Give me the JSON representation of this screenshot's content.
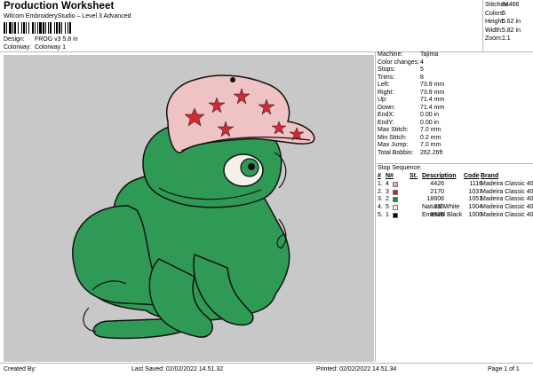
{
  "header": {
    "title": "Production Worksheet",
    "subtitle": "Wilcom EmbroideryStudio – Level 3 Advanced",
    "barcode_label": "barcode",
    "design_label": "Design:",
    "design_value": "FROG v3 5.8 in",
    "colorway_label": "Colorway:",
    "colorway_value": "Colorway 1"
  },
  "summary": [
    {
      "label": "Stitches:",
      "value": "34466"
    },
    {
      "label": "Colors:",
      "value": "5"
    },
    {
      "label": "Height:",
      "value": "5.62 in"
    },
    {
      "label": "Width:",
      "value": "5.82 in"
    },
    {
      "label": "Zoom:",
      "value": "1:1"
    }
  ],
  "machine_info": [
    {
      "label": "Machine:",
      "value": "Tajima"
    },
    {
      "label": "Color changes:",
      "value": "4"
    },
    {
      "label": "Stops:",
      "value": "5"
    },
    {
      "label": "Trims:",
      "value": "8"
    },
    {
      "label": "Left:",
      "value": "73.9 mm"
    },
    {
      "label": "Right:",
      "value": "73.9 mm"
    },
    {
      "label": "Up:",
      "value": "71.4 mm"
    },
    {
      "label": "Down:",
      "value": "71.4 mm"
    },
    {
      "label": "EndX:",
      "value": "0.00 in"
    },
    {
      "label": "EndY:",
      "value": "0.00 in"
    },
    {
      "label": "Max Stitch:",
      "value": "7.0 mm"
    },
    {
      "label": "Min Stitch:",
      "value": "0.2 mm"
    },
    {
      "label": "Max Jump:",
      "value": "7.0 mm"
    },
    {
      "label": "Total Bobbin:",
      "value": "262.26ft"
    }
  ],
  "stop_sequence": {
    "title": "Stop Sequence:",
    "columns": [
      "#",
      "N#",
      "St.",
      "Description",
      "Code",
      "Brand"
    ],
    "rows": [
      {
        "num": "1.",
        "n": "4",
        "color": "#e9a6ad",
        "st": "4426",
        "desc": "",
        "code": "1116",
        "brand": "Madeira Classic 40"
      },
      {
        "num": "2.",
        "n": "3",
        "color": "#c01f2c",
        "st": "2170",
        "desc": "",
        "code": "1037",
        "brand": "Madeira Classic 40"
      },
      {
        "num": "3.",
        "n": "2",
        "color": "#1e8a4d",
        "st": "18606",
        "desc": "",
        "code": "1051",
        "brand": "Madeira Classic 40"
      },
      {
        "num": "4.",
        "n": "5",
        "color": "#f4f1ea",
        "st": "336",
        "desc": "Natural White",
        "code": "1004",
        "brand": "Madeira Classic 40"
      },
      {
        "num": "5.",
        "n": "1",
        "color": "#000000",
        "st": "8926",
        "desc": "Emerald Black",
        "code": "1000",
        "brand": "Madeira Classic 40"
      }
    ]
  },
  "footer": {
    "created_by": "Created By:",
    "last_saved": "Last Saved: 02/02/2022 14.51.32",
    "printed": "Printed: 02/02/2022 14.51.34",
    "page": "Page 1 of 1"
  },
  "colors": {
    "canvas_bg": "#c8c8c8",
    "frog_green": "#2f9a55",
    "frog_dark": "#1f7a42",
    "hat_pink": "#efc3c3",
    "star_red": "#cf2b35",
    "eye_white": "#f4f1ea",
    "outline": "#111111"
  }
}
